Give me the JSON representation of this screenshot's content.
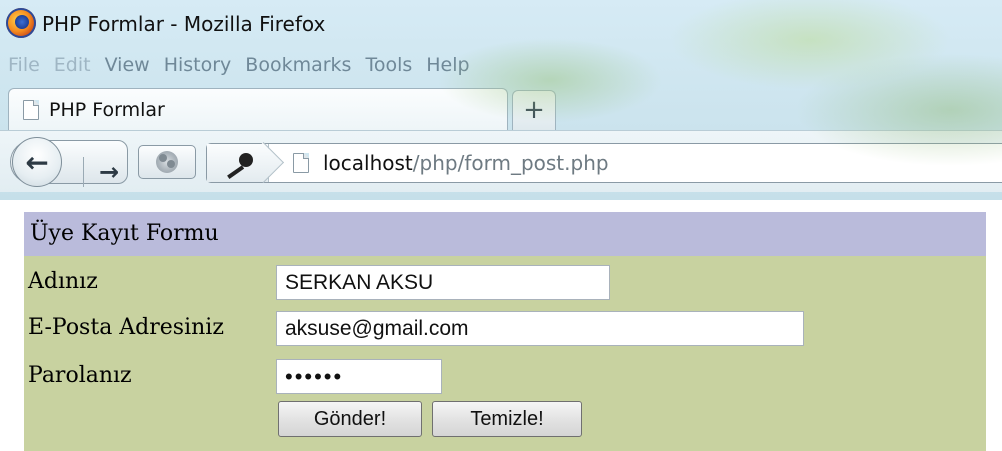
{
  "window": {
    "title": "PHP Formlar - Mozilla Firefox"
  },
  "menubar": {
    "items": [
      {
        "label": "File"
      },
      {
        "label": "Edit"
      },
      {
        "label": "View"
      },
      {
        "label": "History"
      },
      {
        "label": "Bookmarks"
      },
      {
        "label": "Tools"
      },
      {
        "label": "Help"
      }
    ]
  },
  "tabs": [
    {
      "label": "PHP Formlar",
      "active": true
    }
  ],
  "new_tab": {
    "label": "+"
  },
  "nav": {
    "back_icon": "←",
    "forward_icon": "→",
    "url_host": "localhost",
    "url_path": "/php/form_post.php"
  },
  "form": {
    "header": "Üye Kayıt Formu",
    "fields": [
      {
        "label": "Adınız",
        "value": "SERKAN AKSU"
      },
      {
        "label": "E-Posta Adresiniz",
        "value": "aksuse@gmail.com"
      },
      {
        "label": "Parolanız",
        "value": "asdasd"
      }
    ],
    "submit_label": "Gönder!",
    "reset_label": "Temizle!"
  },
  "colors": {
    "form_background": "#c8d2a0",
    "header_background": "#babbdb"
  },
  "icons": {
    "app": "firefox-icon",
    "page": "page-icon",
    "identity": "key-icon",
    "reload": "reload-icon"
  }
}
